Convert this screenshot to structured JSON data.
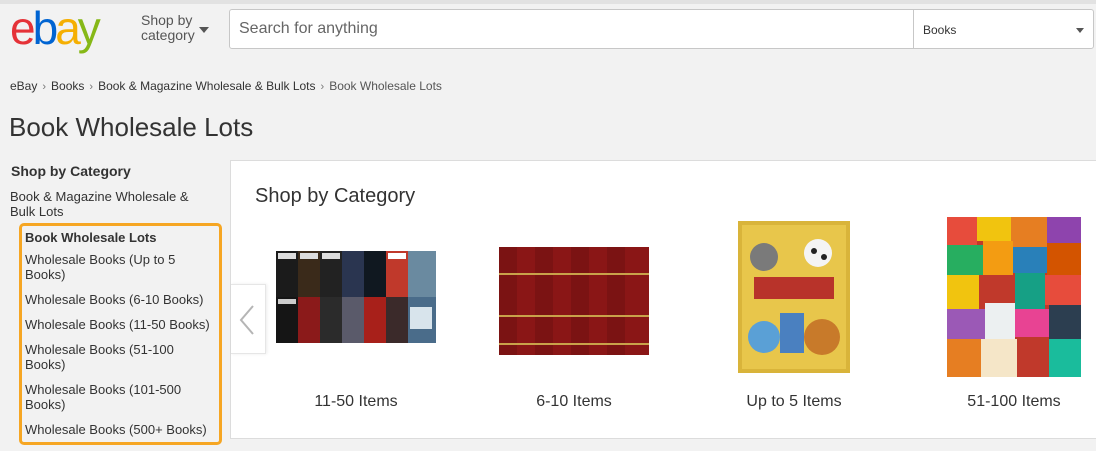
{
  "header": {
    "shop_by_line1": "Shop by",
    "shop_by_line2": "category",
    "search_placeholder": "Search for anything",
    "category_selected": "Books",
    "brand_colors": [
      "#e53238",
      "#0064d2",
      "#f5af02",
      "#86b817"
    ]
  },
  "breadcrumb": {
    "items": [
      "eBay",
      "Books",
      "Book & Magazine Wholesale & Bulk Lots",
      "Book Wholesale Lots"
    ]
  },
  "page_title": "Book Wholesale Lots",
  "sidebar": {
    "heading": "Shop by Category",
    "parent_line1": "Book & Magazine Wholesale &",
    "parent_line2": "Bulk Lots",
    "current": "Book Wholesale Lots",
    "items": [
      {
        "line1": "Wholesale Books (Up to 5",
        "line2": "Books)"
      },
      {
        "line1": "Wholesale Books (6-10 Books)",
        "line2": ""
      },
      {
        "line1": "Wholesale Books (11-50 Books)",
        "line2": ""
      },
      {
        "line1": "Wholesale Books (51-100",
        "line2": "Books)"
      },
      {
        "line1": "Wholesale Books (101-500",
        "line2": "Books)"
      },
      {
        "line1": "Wholesale Books (500+ Books)",
        "line2": ""
      }
    ],
    "highlight_color": "#f6a623"
  },
  "main": {
    "title": "Shop by Category",
    "cards": [
      {
        "label": "11-50 Items",
        "image": "thriller-paperbacks-lot"
      },
      {
        "label": "6-10 Items",
        "image": "red-encyclopedia-set"
      },
      {
        "label": "Up to 5 Items",
        "image": "little-golden-book-library"
      },
      {
        "label": "51-100 Items",
        "image": "colorful-paperback-pile"
      }
    ]
  }
}
